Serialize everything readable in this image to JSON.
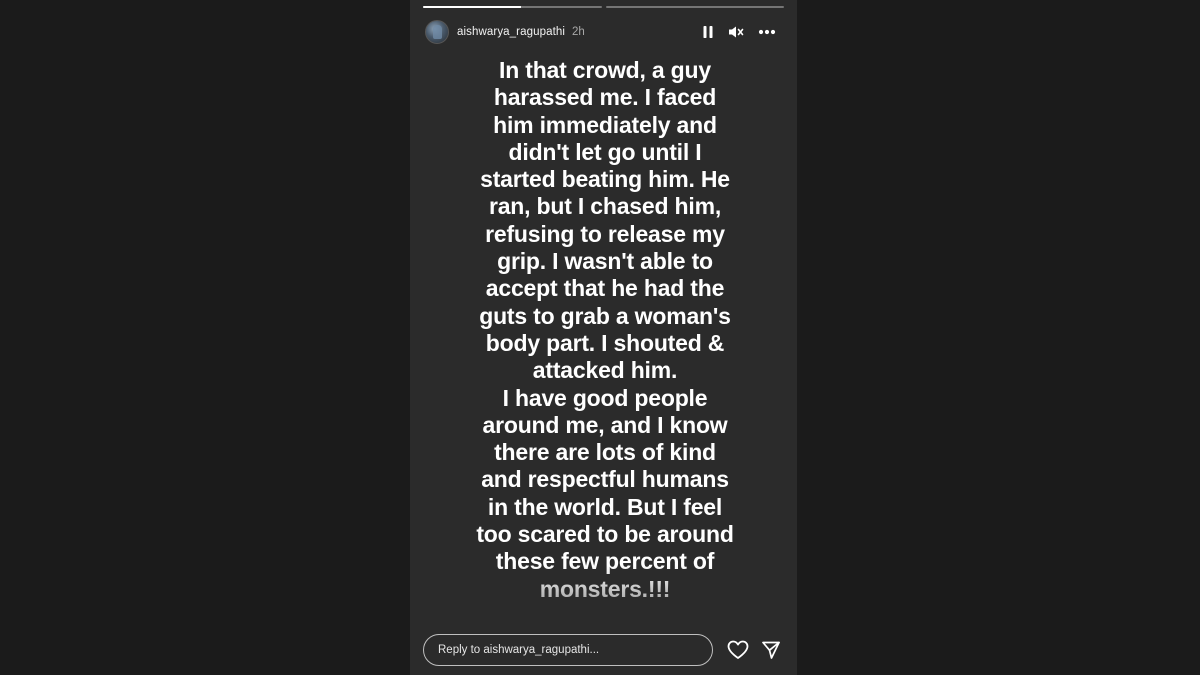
{
  "story": {
    "progress": [
      0.55,
      0.0
    ],
    "author": {
      "username": "aishwarya_ragupathi",
      "time_ago": "2h"
    },
    "controls": {
      "pause_icon": "pause-icon",
      "mute_icon": "speaker-muted-icon",
      "more_icon": "more-options-icon"
    },
    "text": {
      "paragraph_1": "In that crowd, a guy\nharassed me. I faced\nhim immediately and\ndidn't let go until I\nstarted beating him. He\nran, but I chased him,\nrefusing to release my\ngrip. I wasn't able to\naccept that he had the\nguts to grab a woman's\nbody part. I shouted &\nattacked him.",
      "paragraph_2": "I have good people\naround me, and I know\nthere are lots of kind\nand respectful humans\nin the world. But I feel\ntoo scared to be around\nthese few percent of\nmonsters.!!!"
    },
    "reply": {
      "placeholder": "Reply to aishwarya_ragupathi..."
    },
    "footer_icons": {
      "like": "heart-icon",
      "share": "send-icon"
    }
  },
  "colors": {
    "page_background": "#1b1b1b",
    "story_background": "#2b2b2b",
    "text": "#ffffff"
  }
}
